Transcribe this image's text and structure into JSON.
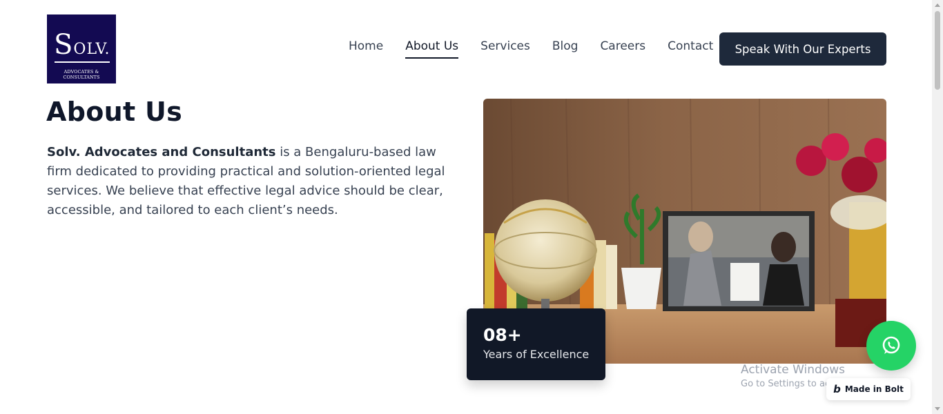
{
  "logo": {
    "mark_first": "S",
    "mark_rest": "OLV.",
    "subtitle": "ADVOCATES & CONSULTANTS"
  },
  "nav": {
    "items": [
      {
        "label": "Home"
      },
      {
        "label": "About Us"
      },
      {
        "label": "Services"
      },
      {
        "label": "Blog"
      },
      {
        "label": "Careers"
      },
      {
        "label": "Contact"
      }
    ],
    "active": "About Us",
    "cta_label": "Speak With Our Experts"
  },
  "about": {
    "title": "About Us",
    "firm_name": "Solv. Advocates and Consultants",
    "description": " is a Bengaluru-based law firm dedicated to providing practical and solution-oriented legal services. We believe that effective legal advice should be clear, accessible, and tailored to each client’s needs."
  },
  "stat": {
    "value": "08+",
    "label": "Years of Excellence"
  },
  "overlays": {
    "activate_title": "Activate Windows",
    "activate_sub": "Go to Settings to activate Windows.",
    "bolt_label": "Made in Bolt",
    "bolt_mark": "b"
  },
  "icons": {
    "whatsapp": "whatsapp-icon",
    "bolt": "bolt-logo-icon"
  },
  "colors": {
    "logo_bg": "#130a52",
    "cta_bg": "#1e293b",
    "stat_bg": "#111827",
    "whatsapp": "#25d366"
  }
}
